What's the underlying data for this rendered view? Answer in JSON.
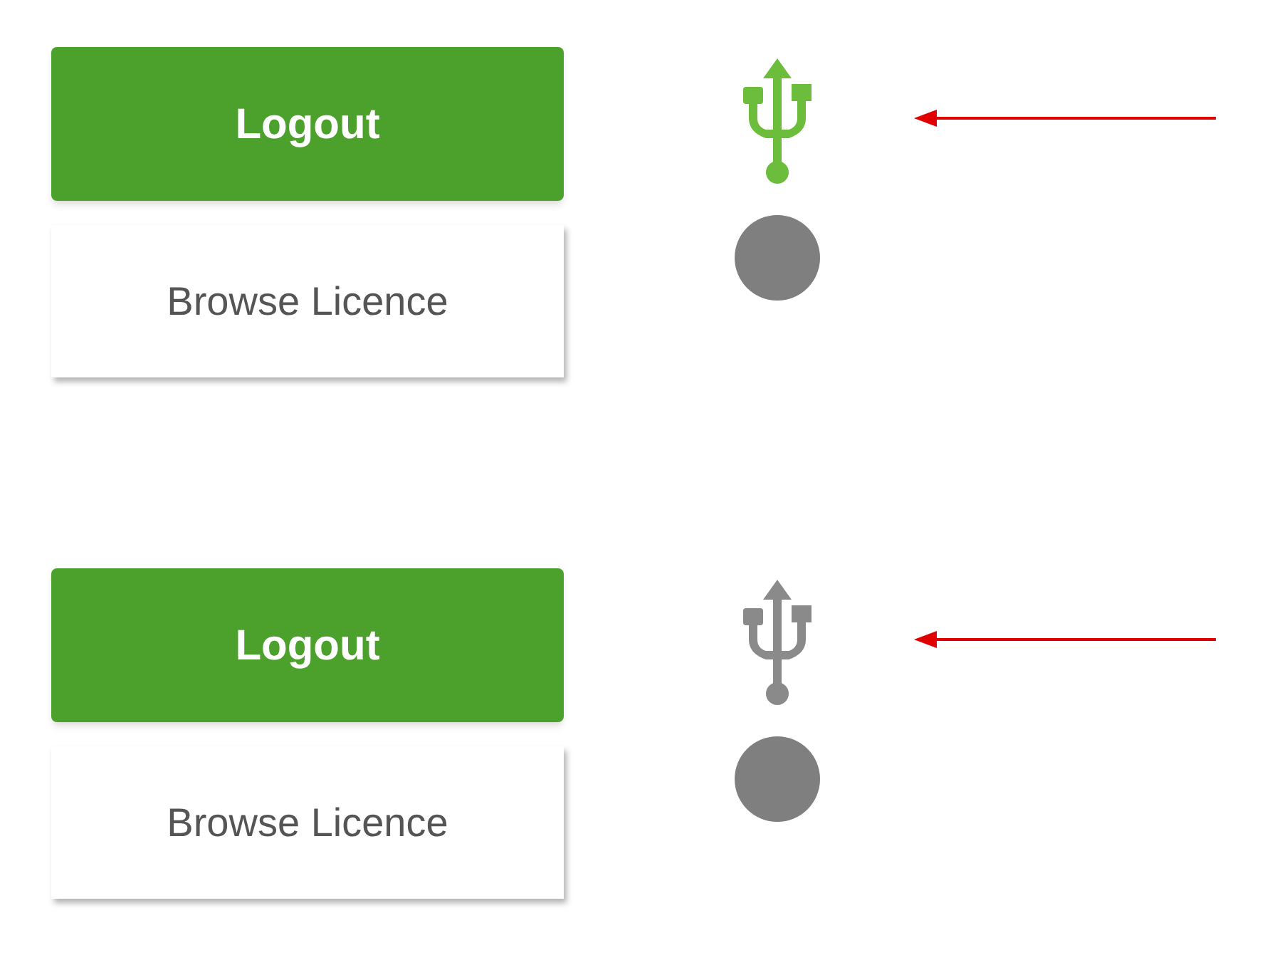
{
  "panels": [
    {
      "logout_button": "Logout",
      "browse_button": "Browse Licence",
      "usb_connected": true
    },
    {
      "logout_button": "Logout",
      "browse_button": "Browse Licence",
      "usb_connected": false
    }
  ]
}
